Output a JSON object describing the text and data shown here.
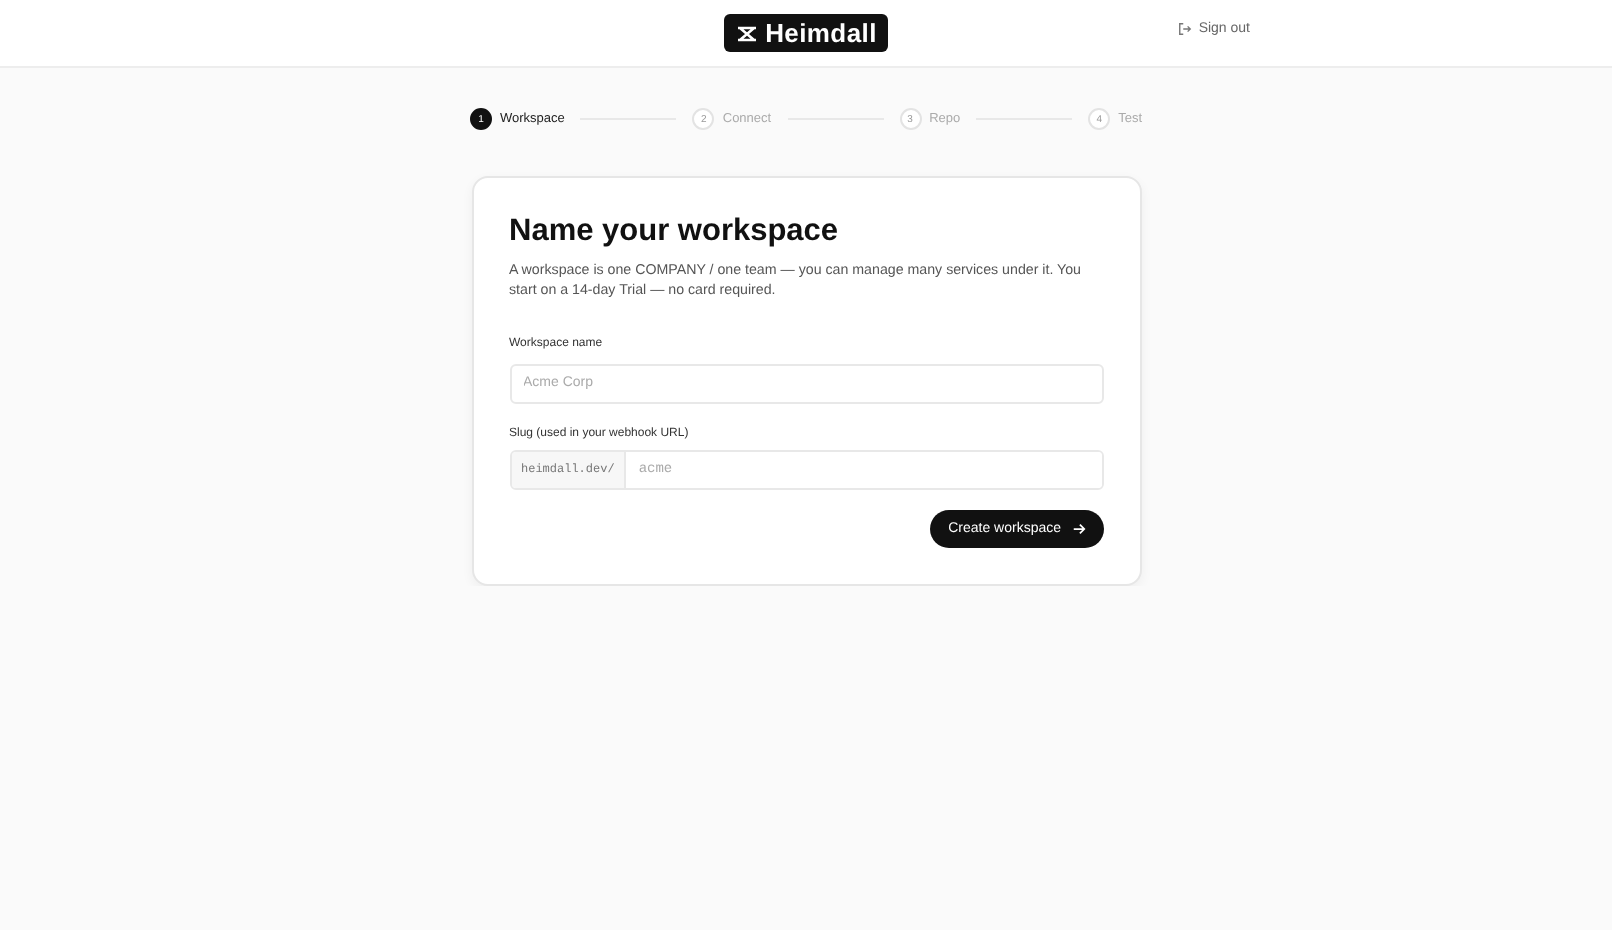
{
  "header": {
    "logo": "Heimdall",
    "sign_out": "Sign out"
  },
  "steps": [
    {
      "number": "1",
      "label": "Workspace",
      "selected": true
    },
    {
      "number": "2",
      "label": "Connect",
      "selected": false
    },
    {
      "number": "3",
      "label": "Repo",
      "selected": false
    },
    {
      "number": "4",
      "label": "Test",
      "selected": false
    }
  ],
  "card": {
    "title": "Name your workspace",
    "description": "A workspace is one COMPANY / one team — you can manage many services under it. You start on a 14-day Trial — no card required.",
    "workspace_name": {
      "label": "Workspace name",
      "placeholder": "Acme Corp"
    },
    "slug": {
      "label": "Slug (used in your webhook URL)",
      "prefix": "heimdall.dev/",
      "placeholder": "acme"
    },
    "submit": "Create workspace"
  }
}
